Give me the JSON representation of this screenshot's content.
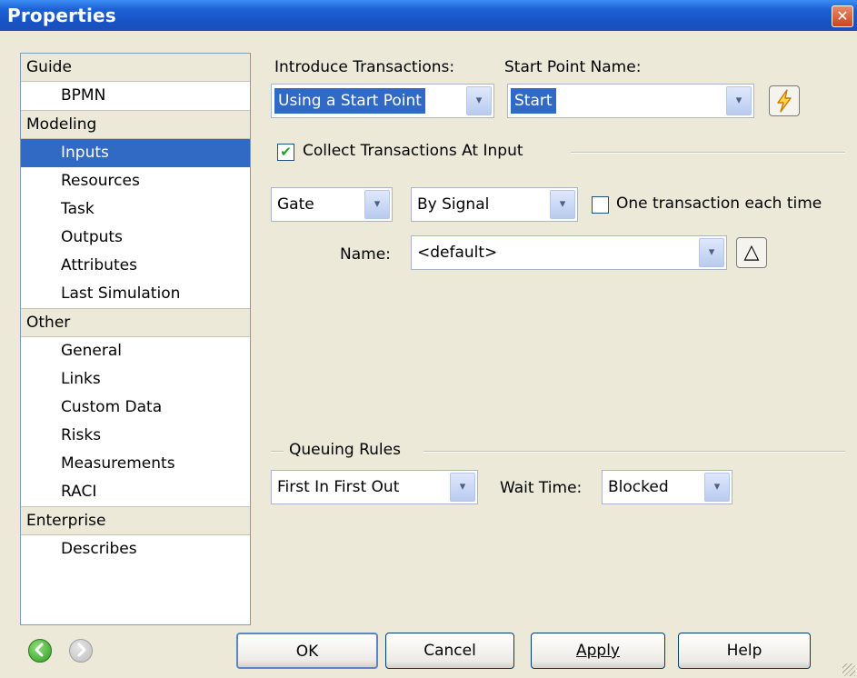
{
  "window": {
    "title": "Properties",
    "close_glyph": "✕"
  },
  "sidebar": {
    "groups": [
      {
        "label": "Guide",
        "items": [
          "BPMN"
        ]
      },
      {
        "label": "Modeling",
        "items": [
          "Inputs",
          "Resources",
          "Task",
          "Outputs",
          "Attributes",
          "Last Simulation"
        ]
      },
      {
        "label": "Other",
        "items": [
          "General",
          "Links",
          "Custom Data",
          "Risks",
          "Measurements",
          "RACI"
        ]
      },
      {
        "label": "Enterprise",
        "items": [
          "Describes"
        ]
      }
    ],
    "selected": "Inputs"
  },
  "form": {
    "introduce_label": "Introduce Transactions:",
    "introduce_value": "Using a Start Point",
    "start_point_label": "Start Point Name:",
    "start_point_value": "Start",
    "collect_label": "Collect Transactions At Input",
    "collect_checked": true,
    "gate_value": "Gate",
    "signal_value": "By Signal",
    "one_each_label": "One transaction each time",
    "one_each_checked": false,
    "name_label": "Name:",
    "name_value": "<default>",
    "queuing_label": "Queuing Rules",
    "queue_value": "First In First Out",
    "wait_label": "Wait Time:",
    "wait_value": "Blocked"
  },
  "buttons": {
    "ok": "OK",
    "cancel": "Cancel",
    "apply": "Apply",
    "help": "Help"
  },
  "icons": {
    "dropdown": "▾",
    "lightning": "lightning-icon",
    "triangle": "△",
    "back": "back-arrow-icon",
    "forward": "forward-arrow-icon"
  },
  "colors": {
    "selection": "#316ac5",
    "titlebar": "#1e62d6"
  }
}
